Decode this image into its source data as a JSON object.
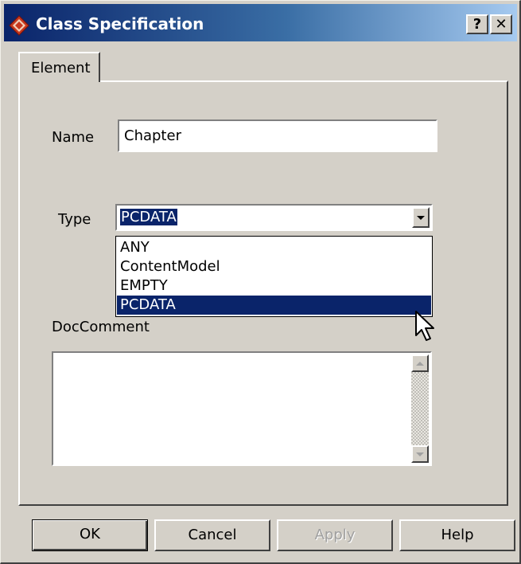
{
  "window": {
    "title": "Class Specification"
  },
  "caption_buttons": {
    "help": "?",
    "close": "✕"
  },
  "tabs": [
    {
      "label": "Element"
    }
  ],
  "form": {
    "name_label": "Name",
    "name_value": "Chapter",
    "type_label": "Type",
    "type_value": "PCDATA",
    "doccomment_label": "DocComment",
    "doccomment_value": ""
  },
  "type_options": [
    "ANY",
    "ContentModel",
    "EMPTY",
    "PCDATA"
  ],
  "type_selected": "PCDATA",
  "buttons": {
    "ok": "OK",
    "cancel": "Cancel",
    "apply": "Apply",
    "help": "Help"
  },
  "icons": {
    "app": "class-spec-diamond-icon",
    "dropdown": "chevron-down-icon",
    "scroll_up": "arrow-up-icon",
    "scroll_down": "arrow-down-icon",
    "cursor": "mouse-pointer-icon"
  },
  "colors": {
    "title_start": "#0a246a",
    "title_end": "#a6caf0",
    "selection": "#0a246a",
    "face": "#d4d0c8"
  }
}
